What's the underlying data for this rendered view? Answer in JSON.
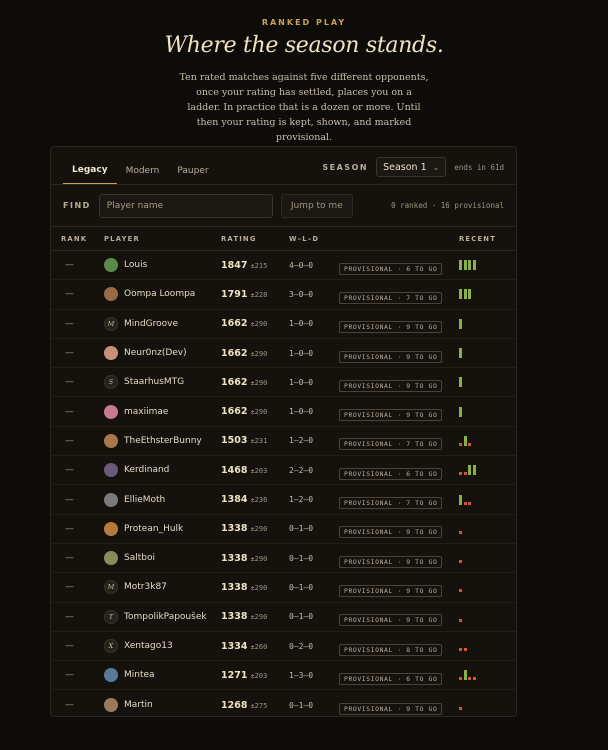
{
  "hero": {
    "kicker": "RANKED PLAY",
    "title": "Where the season stands.",
    "description": "Ten rated matches against five different opponents, once your rating has settled, places you on a ladder. In practice that is a dozen or more. Until then your rating is kept, shown, and marked provisional."
  },
  "tabs": [
    {
      "label": "Legacy",
      "active": true
    },
    {
      "label": "Modern",
      "active": false
    },
    {
      "label": "Pauper",
      "active": false
    }
  ],
  "season": {
    "label": "SEASON",
    "selected": "Season 1",
    "ends": "ends in 61d"
  },
  "find": {
    "label": "FIND",
    "placeholder": "Player name",
    "jump_label": "Jump to me",
    "counts": "0 ranked · 16 provisional"
  },
  "columns": {
    "rank": "RANK",
    "player": "PLAYER",
    "rating": "RATING",
    "wld": "W–L–D",
    "recent": "RECENT"
  },
  "colors": {
    "accent": "#c9a253",
    "win": "#8ab048",
    "loss": "#d2533f",
    "background": "#0e0c09"
  },
  "rows": [
    {
      "rank": "—",
      "name": "Louis",
      "avatar_color": "#5a8a4a",
      "avatar_letter": "",
      "rating": "1847",
      "rd": "±215",
      "wld": "4–0–0",
      "status": "PROVISIONAL · 6 TO GO",
      "recent": [
        "w",
        "w",
        "w",
        "w"
      ]
    },
    {
      "rank": "—",
      "name": "Oompa Loompa",
      "avatar_color": "#9a6a48",
      "avatar_letter": "",
      "rating": "1791",
      "rd": "±228",
      "wld": "3–0–0",
      "status": "PROVISIONAL · 7 TO GO",
      "recent": [
        "w",
        "w",
        "w"
      ]
    },
    {
      "rank": "—",
      "name": "MindGroove",
      "avatar_color": "#25211b",
      "avatar_letter": "M",
      "rating": "1662",
      "rd": "±290",
      "wld": "1–0–0",
      "status": "PROVISIONAL · 9 TO GO",
      "recent": [
        "w"
      ]
    },
    {
      "rank": "—",
      "name": "Neur0nz(Dev)",
      "avatar_color": "#c8907a",
      "avatar_letter": "",
      "rating": "1662",
      "rd": "±290",
      "wld": "1–0–0",
      "status": "PROVISIONAL · 9 TO GO",
      "recent": [
        "w"
      ]
    },
    {
      "rank": "—",
      "name": "StaarhusMTG",
      "avatar_color": "#25211b",
      "avatar_letter": "S",
      "rating": "1662",
      "rd": "±290",
      "wld": "1–0–0",
      "status": "PROVISIONAL · 9 TO GO",
      "recent": [
        "w"
      ]
    },
    {
      "rank": "—",
      "name": "maxiimae",
      "avatar_color": "#c87a90",
      "avatar_letter": "",
      "rating": "1662",
      "rd": "±290",
      "wld": "1–0–0",
      "status": "PROVISIONAL · 9 TO GO",
      "recent": [
        "w"
      ]
    },
    {
      "rank": "—",
      "name": "TheEthsterBunny",
      "avatar_color": "#a8784a",
      "avatar_letter": "",
      "rating": "1503",
      "rd": "±231",
      "wld": "1–2–0",
      "status": "PROVISIONAL · 7 TO GO",
      "recent": [
        "l",
        "w",
        "l"
      ]
    },
    {
      "rank": "—",
      "name": "Kerdinand",
      "avatar_color": "#6a5a7a",
      "avatar_letter": "",
      "rating": "1468",
      "rd": "±203",
      "wld": "2–2–0",
      "status": "PROVISIONAL · 6 TO GO",
      "recent": [
        "l",
        "l",
        "w",
        "w"
      ]
    },
    {
      "rank": "—",
      "name": "EllieMoth",
      "avatar_color": "#7a7a7a",
      "avatar_letter": "",
      "rating": "1384",
      "rd": "±236",
      "wld": "1–2–0",
      "status": "PROVISIONAL · 7 TO GO",
      "recent": [
        "w",
        "l",
        "l"
      ]
    },
    {
      "rank": "—",
      "name": "Protean_Hulk",
      "avatar_color": "#b87a3a",
      "avatar_letter": "",
      "rating": "1338",
      "rd": "±290",
      "wld": "0–1–0",
      "status": "PROVISIONAL · 9 TO GO",
      "recent": [
        "l"
      ]
    },
    {
      "rank": "—",
      "name": "Saltboi",
      "avatar_color": "#8a8a5a",
      "avatar_letter": "",
      "rating": "1338",
      "rd": "±290",
      "wld": "0–1–0",
      "status": "PROVISIONAL · 9 TO GO",
      "recent": [
        "l"
      ]
    },
    {
      "rank": "—",
      "name": "Motr3k87",
      "avatar_color": "#25211b",
      "avatar_letter": "M",
      "rating": "1338",
      "rd": "±290",
      "wld": "0–1–0",
      "status": "PROVISIONAL · 9 TO GO",
      "recent": [
        "l"
      ]
    },
    {
      "rank": "—",
      "name": "TompolikPapoušek",
      "avatar_color": "#25211b",
      "avatar_letter": "T",
      "rating": "1338",
      "rd": "±290",
      "wld": "0–1–0",
      "status": "PROVISIONAL · 9 TO GO",
      "recent": [
        "l"
      ]
    },
    {
      "rank": "—",
      "name": "Xentago13",
      "avatar_color": "#25211b",
      "avatar_letter": "X",
      "rating": "1334",
      "rd": "±260",
      "wld": "0–2–0",
      "status": "PROVISIONAL · 8 TO GO",
      "recent": [
        "l",
        "l"
      ]
    },
    {
      "rank": "—",
      "name": "Mintea",
      "avatar_color": "#5a7a9a",
      "avatar_letter": "",
      "rating": "1271",
      "rd": "±203",
      "wld": "1–3–0",
      "status": "PROVISIONAL · 6 TO GO",
      "recent": [
        "l",
        "w",
        "l",
        "l"
      ]
    },
    {
      "rank": "—",
      "name": "Martin",
      "avatar_color": "#9a7a5a",
      "avatar_letter": "",
      "rating": "1268",
      "rd": "±275",
      "wld": "0–1–0",
      "status": "PROVISIONAL · 9 TO GO",
      "recent": [
        "l"
      ]
    }
  ]
}
